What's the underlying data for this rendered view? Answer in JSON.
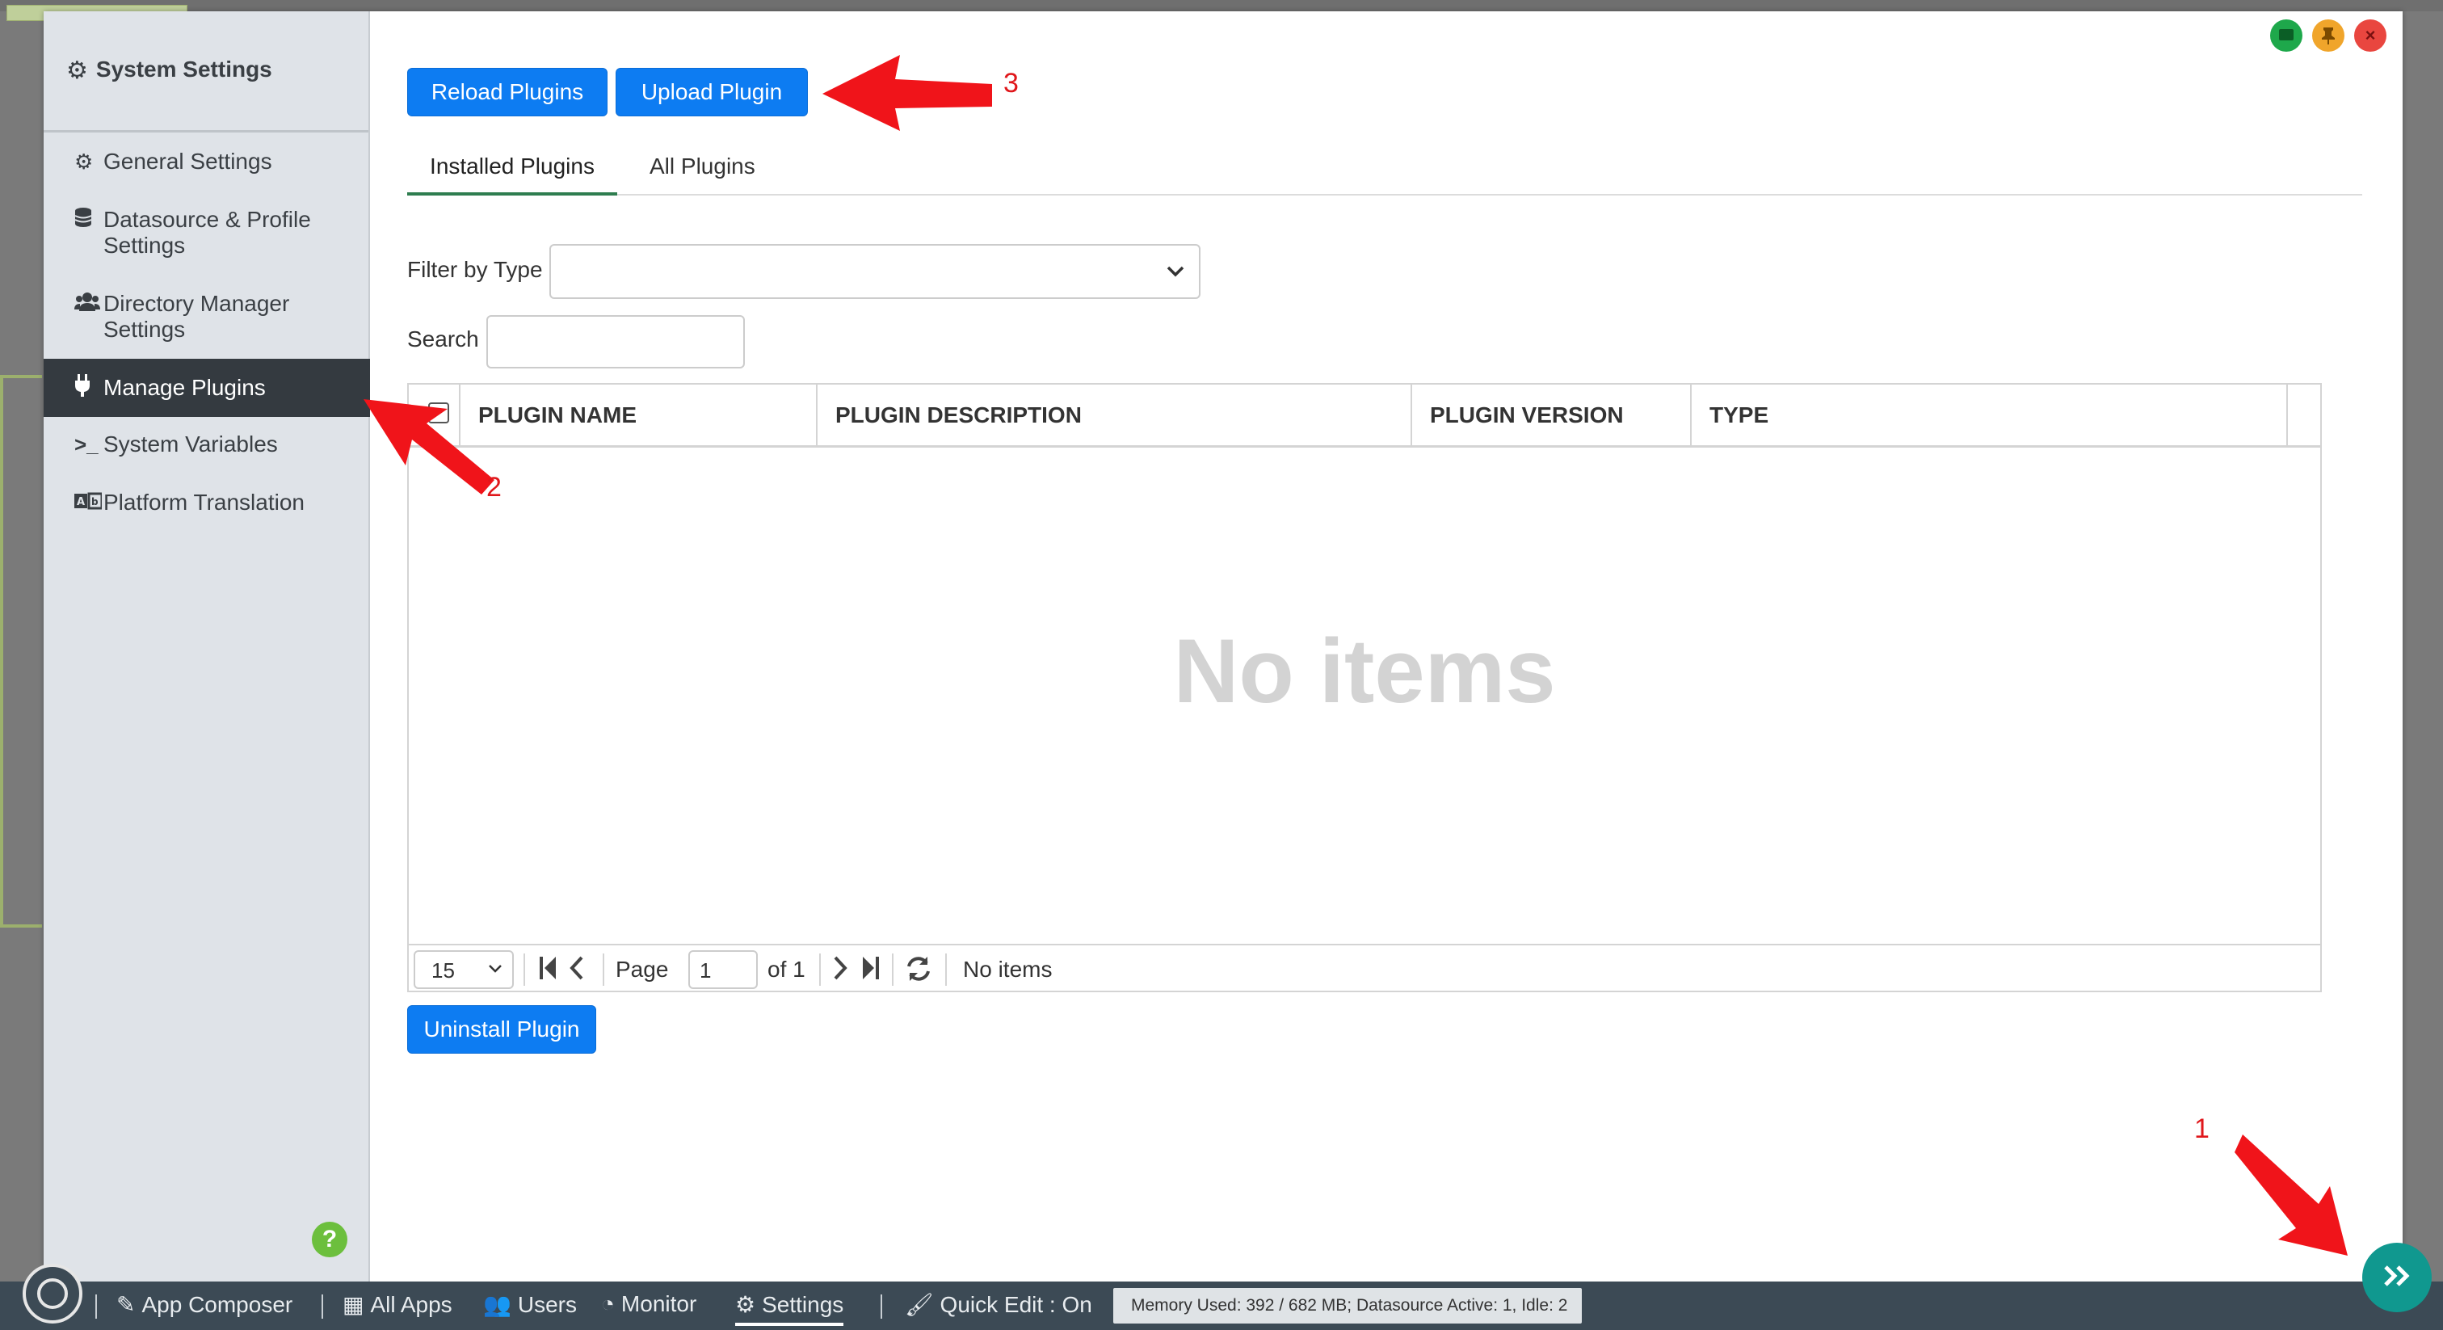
{
  "sidebar": {
    "title": "System Settings",
    "items": [
      {
        "label": "General Settings"
      },
      {
        "label": "Datasource & Profile Settings"
      },
      {
        "label": "Directory Manager Settings"
      },
      {
        "label": "Manage Plugins"
      },
      {
        "label": "System Variables"
      },
      {
        "label": "Platform Translation"
      }
    ],
    "active_item": "Manage Plugins",
    "help_label": "?"
  },
  "window_controls": {
    "close_label": "×"
  },
  "toolbar": {
    "reload_label": "Reload Plugins",
    "upload_label": "Upload Plugin"
  },
  "tabs": [
    {
      "label": "Installed Plugins",
      "active": true
    },
    {
      "label": "All Plugins",
      "active": false
    }
  ],
  "filters": {
    "filter_label": "Filter by Type",
    "filter_value": "",
    "search_label": "Search",
    "search_value": ""
  },
  "table": {
    "columns": [
      "PLUGIN NAME",
      "PLUGIN DESCRIPTION",
      "PLUGIN VERSION",
      "TYPE"
    ],
    "rows": [],
    "empty_text": "No items"
  },
  "pager": {
    "page_size": "15",
    "page_label": "Page",
    "page_value": "1",
    "of_label": "of 1",
    "status": "No items"
  },
  "actions": {
    "uninstall_label": "Uninstall Plugin"
  },
  "annotations": {
    "one": "1",
    "two": "2",
    "three": "3"
  },
  "taskbar": {
    "items": [
      {
        "label": "App Composer"
      },
      {
        "label": "All Apps"
      },
      {
        "label": "Users"
      },
      {
        "label": "Monitor"
      },
      {
        "label": "Settings"
      },
      {
        "label": "Quick Edit : On"
      }
    ],
    "memory_status": "Memory Used: 392 / 682 MB; Datasource Active: 1, Idle: 2"
  },
  "colors": {
    "primary": "#0d7cf2",
    "sidebar_active": "#343a40",
    "taskbar": "#3c4a55",
    "fab": "#10988f",
    "annotation": "#e0171b"
  }
}
